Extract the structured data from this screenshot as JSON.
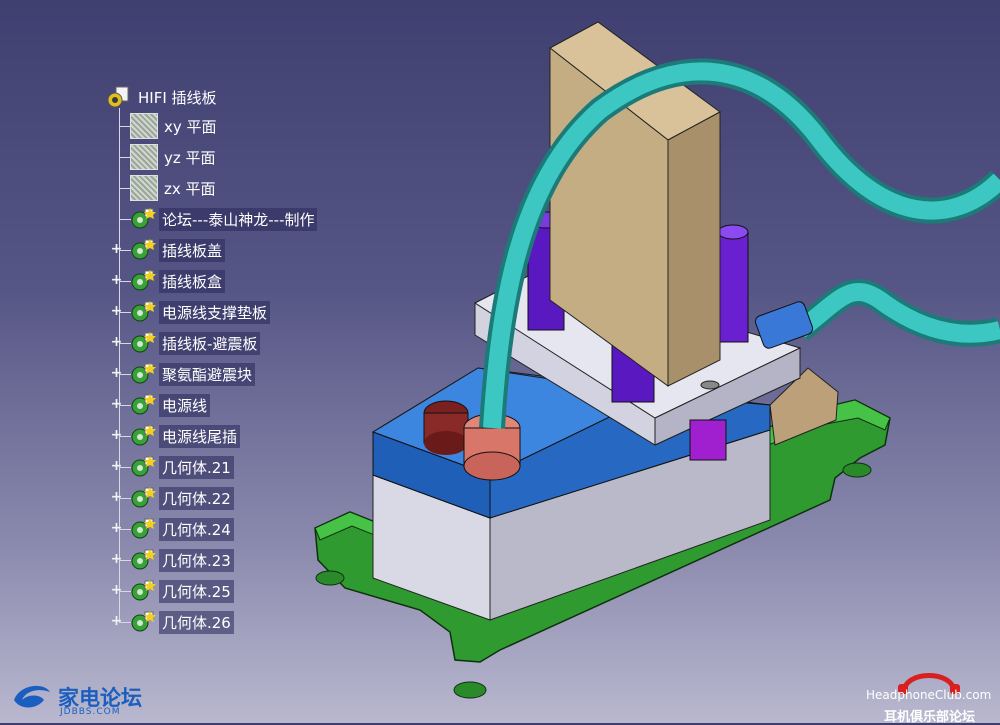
{
  "tree": {
    "root": {
      "label": "HIFI 插线板",
      "icon": "product-icon"
    },
    "nodes": [
      {
        "label": "xy 平面",
        "icon": "plane-icon",
        "kind": "plane",
        "expandable": false
      },
      {
        "label": "yz 平面",
        "icon": "plane-icon",
        "kind": "plane",
        "expandable": false
      },
      {
        "label": "zx 平面",
        "icon": "plane-icon",
        "kind": "plane",
        "expandable": false
      },
      {
        "label": "论坛---泰山神龙---制作",
        "icon": "part-body-icon",
        "kind": "part",
        "expandable": false
      },
      {
        "label": "插线板盖",
        "icon": "part-body-icon",
        "kind": "part",
        "expandable": true
      },
      {
        "label": "插线板盒",
        "icon": "part-body-icon",
        "kind": "part",
        "expandable": true
      },
      {
        "label": "电源线支撑垫板",
        "icon": "part-body-icon",
        "kind": "part",
        "expandable": true
      },
      {
        "label": "插线板-避震板",
        "icon": "part-body-icon",
        "kind": "part",
        "expandable": true
      },
      {
        "label": "聚氨酯避震块",
        "icon": "part-body-icon",
        "kind": "part",
        "expandable": true
      },
      {
        "label": "电源线",
        "icon": "part-body-icon",
        "kind": "part",
        "expandable": true
      },
      {
        "label": "电源线尾插",
        "icon": "part-body-icon",
        "kind": "part",
        "expandable": true
      },
      {
        "label": "几何体.21",
        "icon": "part-body-icon",
        "kind": "part",
        "expandable": true
      },
      {
        "label": "几何体.22",
        "icon": "part-body-icon",
        "kind": "part",
        "expandable": true
      },
      {
        "label": "几何体.24",
        "icon": "part-body-icon",
        "kind": "part",
        "expandable": true
      },
      {
        "label": "几何体.23",
        "icon": "part-body-icon",
        "kind": "part",
        "expandable": true
      },
      {
        "label": "几何体.25",
        "icon": "part-body-icon",
        "kind": "part",
        "expandable": true
      },
      {
        "label": "几何体.26",
        "icon": "part-body-icon",
        "kind": "part",
        "expandable": true
      }
    ],
    "expander_symbol": "+"
  },
  "watermarks": {
    "left_brand": "家电论坛",
    "left_sub": "JDBBS.COM",
    "right_brand": "HeadphoneClub.com",
    "right_sub": "耳机俱乐部论坛"
  },
  "colors": {
    "background_top": "#3f3f70",
    "background_bottom": "#b9b8cf",
    "base_plate": "#2fae2f",
    "box_top": "#2f79d6",
    "box_side": "#dcdce8",
    "cable": "#33b8b3",
    "block": "#c8b48a",
    "pins": "#6a1fd0"
  }
}
